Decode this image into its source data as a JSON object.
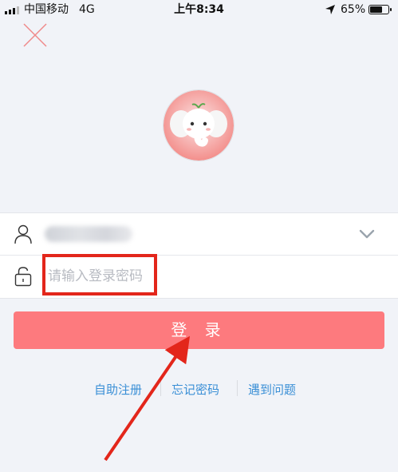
{
  "status_bar": {
    "carrier": "中国移动",
    "network": "4G",
    "time": "上午8:34",
    "battery": "65%"
  },
  "login": {
    "password_placeholder": "请输入登录密码",
    "login_button": "登 录"
  },
  "links": {
    "register": "自助注册",
    "forgot": "忘记密码",
    "problem": "遇到问题"
  },
  "colors": {
    "login_button": "#fd7a7e",
    "link": "#3a8fd6",
    "annotation": "#e3261b"
  },
  "icons": [
    "close-icon",
    "user-icon",
    "lock-icon",
    "chevron-down-icon",
    "location-arrow-icon",
    "battery-icon",
    "signal-icon"
  ]
}
